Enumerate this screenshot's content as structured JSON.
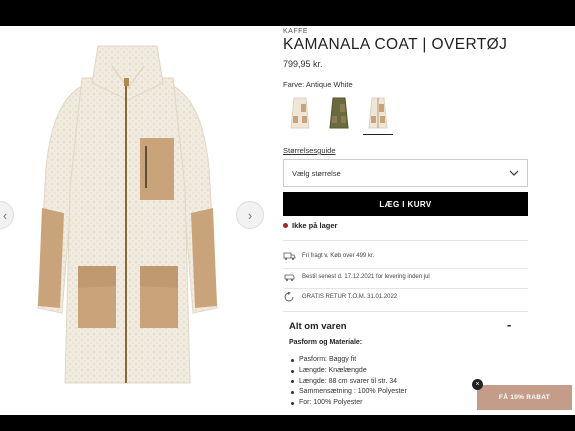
{
  "product": {
    "brand": "KAFFE",
    "title": "KAMANALA COAT | OVERTØJ",
    "price": "799,95 kr.",
    "color_label": "Farve: Antique White",
    "swatches": [
      {
        "name": "Antique White",
        "body_color": "#efe6d8",
        "patch_color": "#c8a27a"
      },
      {
        "name": "Olive",
        "body_color": "#6b6a3e",
        "patch_color": "#8a7d55"
      },
      {
        "name": "Antique White Patch",
        "body_color": "#efe6d8",
        "patch_color": "#c8a27a"
      }
    ],
    "selected_swatch": 2
  },
  "size": {
    "guide_label": "Størrelsesguide",
    "select_placeholder": "Vælg størrelse"
  },
  "cart": {
    "button_label": "LÆG I KURV"
  },
  "stock": {
    "label": "Ikke på lager",
    "status_color": "#9c2a2a"
  },
  "services": [
    {
      "icon": "truck-icon",
      "text": "Fri fragt v. Køb over 499 kr."
    },
    {
      "icon": "delivery-icon",
      "text": "Bestil senest d. 17.12.2021 for levering inden jul"
    },
    {
      "icon": "return-icon",
      "text": "GRATIS RETUR T.O.M. 31.01.2022"
    }
  ],
  "details": {
    "title": "Alt om varen",
    "toggle": "-",
    "subhead": "Pasform og Materiale:",
    "items": [
      "Pasform: Baggy fit",
      "Længde: Knælængde",
      "Længde: 88 cm svarer til str. 34",
      "Sammensætning : 100% Polyester",
      "For: 100% Polyester"
    ]
  },
  "discount": {
    "label": "FÅ 10% RABAT",
    "close": "×",
    "color": "#c49c8a"
  },
  "gallery": {
    "prev": "‹",
    "next": "›"
  }
}
